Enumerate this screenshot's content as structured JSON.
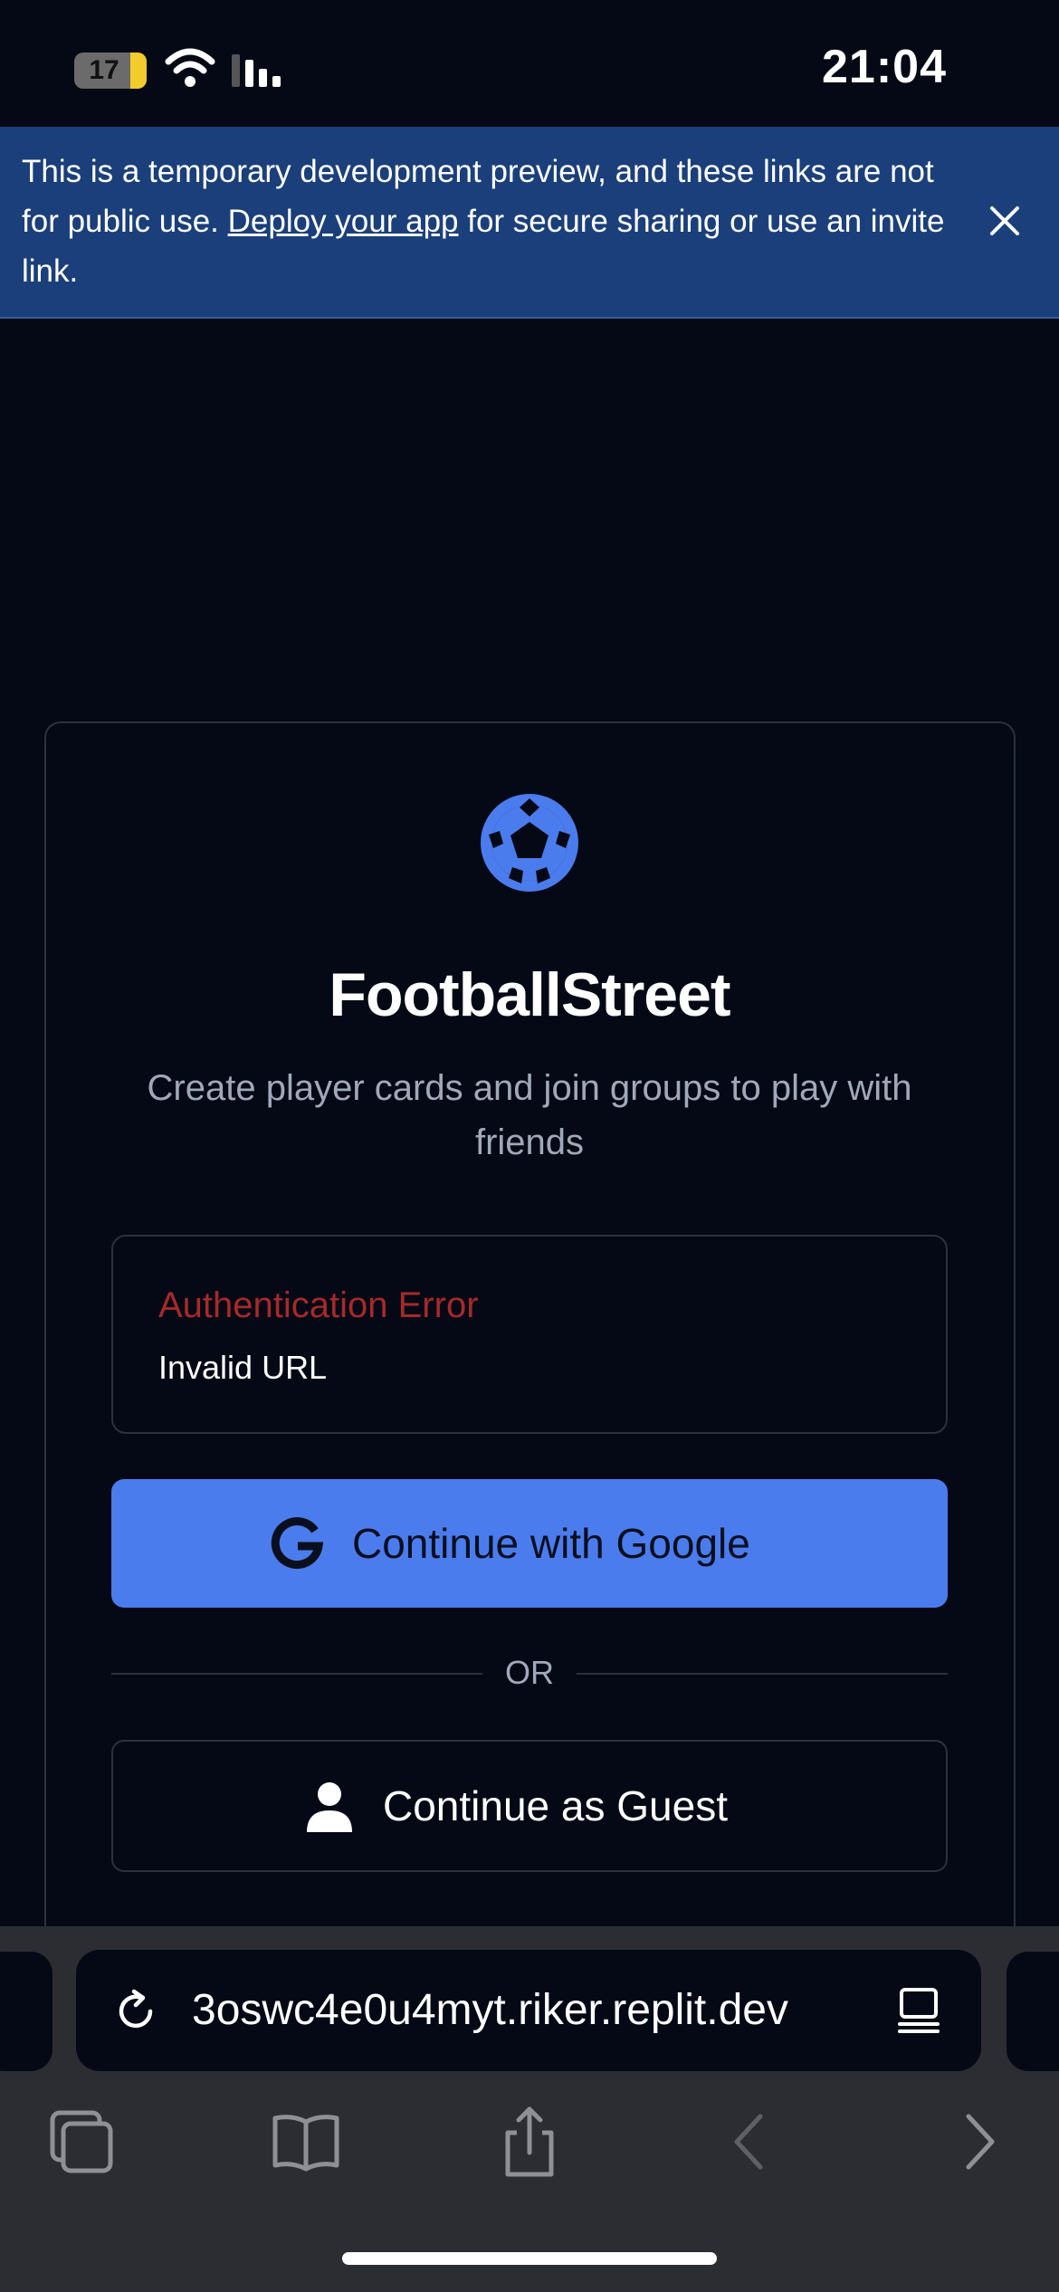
{
  "status_bar": {
    "battery_level": "17",
    "time": "21:04"
  },
  "dev_banner": {
    "text_before": "This is a temporary development preview, and these links are not for public use. ",
    "link_text": "Deploy your app",
    "text_after": " for secure sharing or use an invite link."
  },
  "app": {
    "title": "FootballStreet",
    "subtitle": "Create player cards and join groups to play with friends"
  },
  "error": {
    "title": "Authentication Error",
    "message": "Invalid URL"
  },
  "auth": {
    "google_label": "Continue with Google",
    "divider_text": "OR",
    "guest_label": "Continue as Guest"
  },
  "browser": {
    "url": "3oswc4e0u4myt.riker.replit.dev"
  },
  "colors": {
    "background": "#050915",
    "banner": "#1b3f7a",
    "accent": "#4b7ced",
    "error": "#a52a2a",
    "muted_text": "#a1a9b8"
  },
  "icons": {
    "logo": "soccer-ball-icon",
    "google": "google-g-icon",
    "guest": "user-icon",
    "reload": "reload-icon",
    "reader": "reader-mode-icon",
    "tabs": "tabs-icon",
    "bookmarks": "bookmarks-icon",
    "share": "share-icon",
    "back": "chevron-left-icon",
    "forward": "chevron-right-icon",
    "close": "close-icon"
  }
}
